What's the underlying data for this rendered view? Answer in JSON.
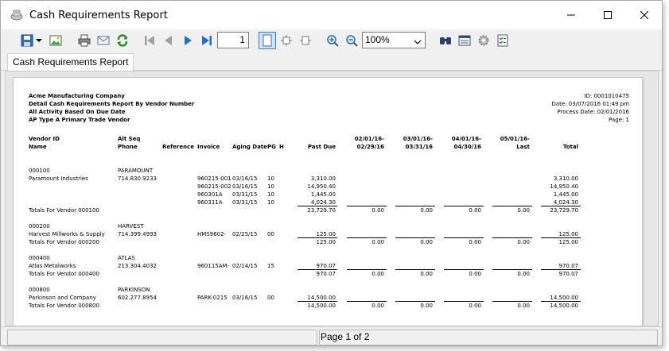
{
  "window": {
    "title": "Cash Requirements Report"
  },
  "toolbar": {
    "icons": [
      "save-icon",
      "dropdown-arrow-icon",
      "export-image-icon",
      "print-icon",
      "email-icon",
      "refresh-icon",
      "first-page-icon",
      "previous-page-icon",
      "next-page-icon",
      "last-page-icon",
      "single-page-icon",
      "fit-page-icon",
      "fit-width-icon",
      "zoom-in-icon",
      "zoom-out-icon",
      "search-icon",
      "layout-icon",
      "settings-icon",
      "checklist-icon"
    ],
    "page_number": "1",
    "zoom": "100%"
  },
  "tab": {
    "label": "Cash Requirements Report"
  },
  "report": {
    "company": "Acme Manufacturing Company",
    "title": "Detail Cash Requirements Report By Vendor Number",
    "basis": "All Activity Based On Due Date",
    "ap_type": "AP Type A  Primary Trade Vendor",
    "id": "ID: 0001010475",
    "date": "Date: 03/07/2016 01:49 pm",
    "process_date": "Process Date: 02/01/2016",
    "page": "Page: 1",
    "columns": {
      "vendor_id": "Vendor ID",
      "name": "Name",
      "alt_seq": "Alt Seq",
      "phone": "Phone",
      "reference": "Reference",
      "invoice": "Invoice",
      "aging_date": "Aging Date",
      "pg": "PG",
      "h": "H",
      "past_due": "Past Due",
      "p1a": "02/01/16-",
      "p1b": "02/29/16",
      "p2a": "03/01/16-",
      "p2b": "03/31/16",
      "p3a": "04/01/16-",
      "p3b": "04/30/16",
      "p4a": "05/01/16-",
      "p4b": "Last",
      "total": "Total"
    },
    "vendors": [
      {
        "id": "000100",
        "alt": "PARAMOUNT",
        "name": "Paramount Industries",
        "phone": "714.830.9233",
        "lines": [
          {
            "invoice": "960215-001",
            "aging": "03/16/15",
            "pg": "10",
            "past_due": "3,310.00",
            "total": "3,310.00"
          },
          {
            "invoice": "960215-002",
            "aging": "03/16/15",
            "pg": "10",
            "past_due": "14,950.40",
            "total": "14,950.40"
          },
          {
            "invoice": "960301A",
            "aging": "03/31/15",
            "pg": "10",
            "past_due": "1,445.00",
            "total": "1,445.00"
          },
          {
            "invoice": "960311A",
            "aging": "03/31/15",
            "pg": "10",
            "past_due": "4,024.30",
            "total": "4,024.30"
          }
        ],
        "totals_label": "Totals For Vendor 000100",
        "totals": {
          "past_due": "23,729.70",
          "p1": "0.00",
          "p2": "0.00",
          "p3": "0.00",
          "p4": "0.00",
          "total": "23,729.70"
        }
      },
      {
        "id": "000200",
        "alt": "HARVEST",
        "name": "Harvest Millworks & Supply",
        "phone": "714.399.4993",
        "lines": [
          {
            "invoice": "HMS9602-",
            "aging": "02/25/15",
            "pg": "00",
            "past_due": "125.00",
            "total": "125.00"
          }
        ],
        "totals_label": "Totals For Vendor 000200",
        "totals": {
          "past_due": "125.00",
          "p1": "0.00",
          "p2": "0.00",
          "p3": "0.00",
          "p4": "0.00",
          "total": "125.00"
        }
      },
      {
        "id": "000400",
        "alt": "ATLAS",
        "name": "Atlas Metalworks",
        "phone": "213.304.4032",
        "lines": [
          {
            "invoice": "960115AM-",
            "aging": "02/14/15",
            "pg": "15",
            "past_due": "970.07",
            "total": "970.07"
          }
        ],
        "totals_label": "Totals For Vendor 000400",
        "totals": {
          "past_due": "970.07",
          "p1": "0.00",
          "p2": "0.00",
          "p3": "0.00",
          "p4": "0.00",
          "total": "970.07"
        }
      },
      {
        "id": "000800",
        "alt": "PARKINSON",
        "name": "Parkinson and Company",
        "phone": "602.277.8954",
        "lines": [
          {
            "invoice": "PARK-0215",
            "aging": "03/16/15",
            "pg": "00",
            "past_due": "14,500.00",
            "total": "14,500.00"
          }
        ],
        "totals_label": "Totals For Vendor 000800",
        "totals": {
          "past_due": "14,500.00",
          "p1": "0.00",
          "p2": "0.00",
          "p3": "0.00",
          "p4": "0.00",
          "total": "14,500.00"
        }
      }
    ]
  },
  "status": {
    "page_text": "Page 1 of 2"
  }
}
